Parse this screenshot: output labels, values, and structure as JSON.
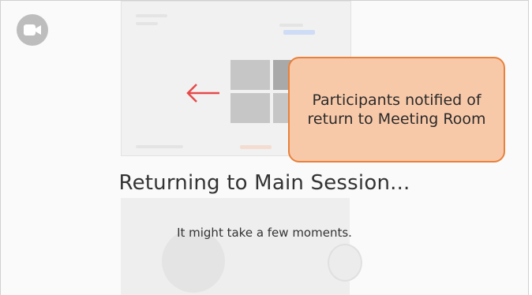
{
  "overlay": {
    "title": "Returning to Main Session...",
    "subtitle": "It might take a few moments."
  },
  "callout": {
    "text": "Participants notified of return to Meeting Room",
    "fill_color": "#f8c9a9",
    "border_color": "#e8813b"
  },
  "colors": {
    "arrow": "#e64a4a",
    "camera_button": "#bdbdbd",
    "grid_cells": "#c6c6c6"
  },
  "icons": {
    "camera": "video-camera-icon",
    "arrow": "arrow-left-icon",
    "rooms": "breakout-rooms-grid-icon"
  }
}
